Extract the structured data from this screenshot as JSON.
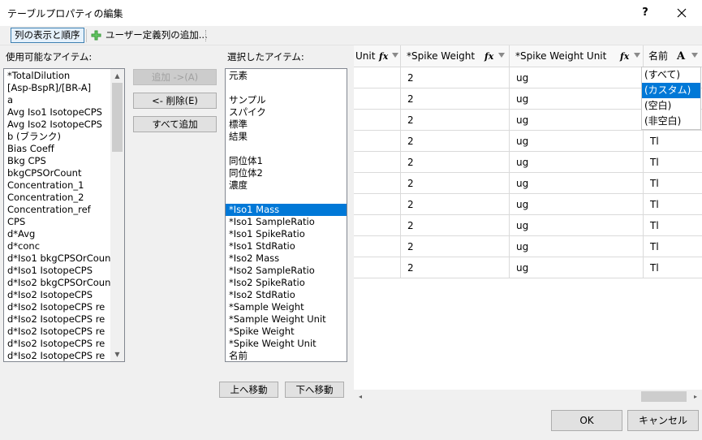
{
  "window": {
    "title": "テーブルプロパティの編集",
    "help_label": "?"
  },
  "toolbar": {
    "columns_btn": "列の表示と順序",
    "add_user_col_btn": "ユーザー定義列の追加..."
  },
  "available": {
    "label": "使用可能なアイテム:",
    "items": [
      "*TotalDilution",
      "[Asp-BspR]/[BR-A]",
      "a",
      "Avg Iso1 IsotopeCPS",
      "Avg Iso2 IsotopeCPS",
      "b (ブランク)",
      "Bias Coeff",
      "Bkg CPS",
      "bkgCPSOrCount",
      "Concentration_1",
      "Concentration_2",
      "Concentration_ref",
      "CPS",
      "d*Avg",
      "d*conc",
      "d*Iso1 bkgCPSOrCount",
      "d*Iso1 IsotopeCPS",
      "d*Iso2 bkgCPSOrCount",
      "d*Iso2 IsotopeCPS",
      "d*Iso2 IsotopeCPS re",
      "d*Iso2 IsotopeCPS re",
      "d*Iso2 IsotopeCPS re",
      "d*Iso2 IsotopeCPS re",
      "d*Iso2 IsotopeCPS re"
    ]
  },
  "buttons": {
    "add": "追加 ->(A)",
    "remove": "<- 削除(E)",
    "add_all": "すべて追加",
    "move_up": "上へ移動",
    "move_down": "下へ移動",
    "ok": "OK",
    "cancel": "キャンセル"
  },
  "selected": {
    "label": "選択したアイテム:",
    "items": [
      "元素",
      "",
      "サンプル",
      "スパイク",
      "標準",
      "結果",
      "",
      "同位体1",
      "同位体2",
      "濃度",
      "",
      "*Iso1 Mass",
      "*Iso1 SampleRatio",
      "*Iso1 SpikeRatio",
      "*Iso1 StdRatio",
      "*Iso2 Mass",
      "*Iso2 SampleRatio",
      "*Iso2 SpikeRatio",
      "*Iso2 StdRatio",
      "*Sample Weight",
      "*Sample Weight Unit",
      "*Spike Weight",
      "*Spike Weight Unit",
      "名前"
    ],
    "selected_index": 11
  },
  "grid": {
    "headers": {
      "unit_partial": "Unit",
      "spike_weight": "*Spike Weight",
      "spike_weight_unit": "*Spike Weight Unit",
      "name": "名前",
      "fx_icon": "fx",
      "font_icon": "A"
    },
    "rows": [
      {
        "spike_weight": "2",
        "spike_weight_unit": "ug",
        "name": ""
      },
      {
        "spike_weight": "2",
        "spike_weight_unit": "ug",
        "name": ""
      },
      {
        "spike_weight": "2",
        "spike_weight_unit": "ug",
        "name": ""
      },
      {
        "spike_weight": "2",
        "spike_weight_unit": "ug",
        "name": "Tl"
      },
      {
        "spike_weight": "2",
        "spike_weight_unit": "ug",
        "name": "Tl"
      },
      {
        "spike_weight": "2",
        "spike_weight_unit": "ug",
        "name": "Tl"
      },
      {
        "spike_weight": "2",
        "spike_weight_unit": "ug",
        "name": "Tl"
      },
      {
        "spike_weight": "2",
        "spike_weight_unit": "ug",
        "name": "Tl"
      },
      {
        "spike_weight": "2",
        "spike_weight_unit": "ug",
        "name": "Tl"
      },
      {
        "spike_weight": "2",
        "spike_weight_unit": "ug",
        "name": "Tl"
      }
    ],
    "filter_dropdown": {
      "options": [
        "(すべて)",
        "(カスタム)",
        "(空白)",
        "(非空白)"
      ],
      "selected_index": 1
    }
  },
  "colors": {
    "selection": "#0078d7",
    "dialog_bg": "#f0f0f0"
  }
}
